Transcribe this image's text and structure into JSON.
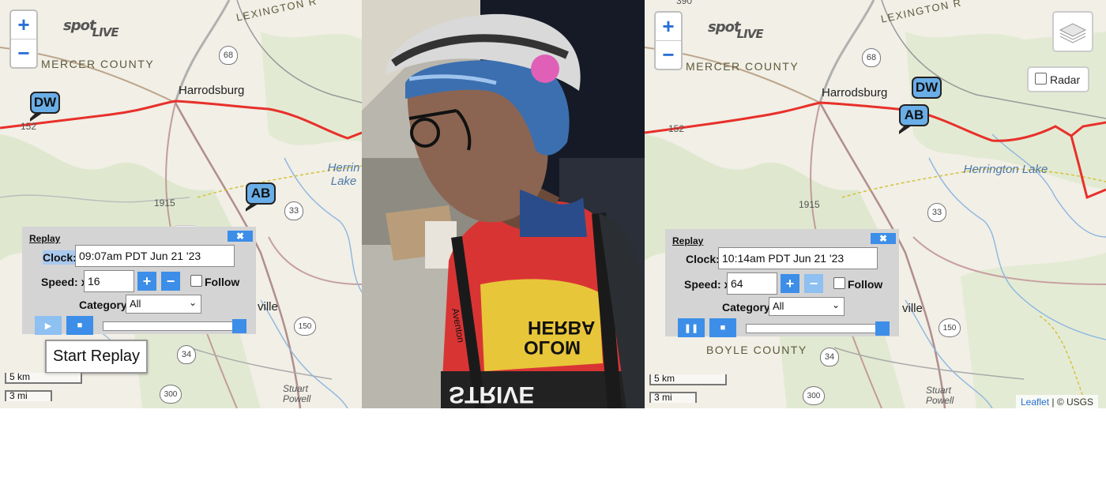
{
  "left_map": {
    "zoom_in": "+",
    "zoom_out": "−",
    "logo_spot": "spot",
    "logo_live": "LIVE",
    "county": "MERCER COUNTY",
    "highway_label": "LEXINGTON R",
    "town": "Harrodsburg",
    "lake": "Herrin Lake",
    "road_1915": "1915",
    "shield_68": "68",
    "shield_33": "33",
    "shield_34": "34",
    "shield_150": "150",
    "shield_300": "300",
    "town_partial": "ville",
    "place_stuart": "Stuart Powell",
    "edge_152": "152",
    "markers": [
      {
        "label": "DW"
      },
      {
        "label": "AB"
      }
    ],
    "replay": {
      "title": "Replay",
      "close": "✖",
      "clock_label": "Clock:",
      "clock_value": "09:07am PDT Jun 21 '23",
      "speed_label": "Speed: x",
      "speed_value": "16",
      "plus": "+",
      "minus": "−",
      "follow_label": "Follow",
      "category_label": "Category:",
      "category_value": "All",
      "play_icon": "▶",
      "stop_icon": "■",
      "progress": 1.0
    },
    "tooltip": "Start Replay",
    "scale_km": "5 km",
    "scale_mi": "3 mi",
    "translate_icon": "G"
  },
  "right_map": {
    "zoom_in": "+",
    "zoom_out": "−",
    "logo_spot": "spot",
    "logo_live": "LIVE",
    "county": "MERCER COUNTY",
    "county2": "BOYLE COUNTY",
    "highway_label": "LEXINGTON R",
    "town": "Harrodsburg",
    "lake": "Herrington Lake",
    "road_1915": "1915",
    "road_390": "390",
    "shield_68": "68",
    "shield_33": "33",
    "shield_34": "34",
    "shield_150": "150",
    "shield_300": "300",
    "town_partial": "ville",
    "place_stuart": "Stuart Powell",
    "edge_152": "152",
    "markers": [
      {
        "label": "DW"
      },
      {
        "label": "AB"
      }
    ],
    "radar_label": "Radar",
    "attribution_link": "Leaflet",
    "attribution_text": "| © USGS",
    "replay": {
      "title": "Replay",
      "close": "✖",
      "clock_label": "Clock:",
      "clock_value": "10:14am PDT Jun 21 '23",
      "speed_label": "Speed: x",
      "speed_value": "64",
      "plus": "+",
      "minus": "−",
      "follow_label": "Follow",
      "category_label": "Category:",
      "category_value": "All",
      "pause_icon": "❚❚",
      "stop_icon": "■",
      "progress": 1.0
    },
    "scale_km": "5 km",
    "scale_mi": "3 mi"
  },
  "photo": {
    "jersey_text_1": "HERBA",
    "jersey_text_2": "OLOM",
    "jersey_text_3": "STRIVE",
    "jersey_text_4": "Aventon"
  },
  "colors": {
    "route": "#e8302a",
    "accent": "#3c8ee8",
    "marker": "#6aaee8"
  }
}
